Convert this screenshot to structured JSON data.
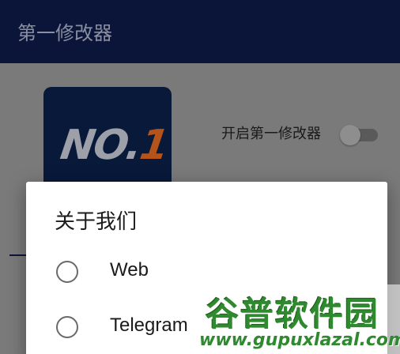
{
  "appbar": {
    "title": "第一修改器"
  },
  "logo": {
    "text_main": "NO.",
    "text_accent": "1"
  },
  "toggle": {
    "label": "开启第一修改器",
    "enabled": false
  },
  "dialog": {
    "title": "关于我们",
    "options": [
      {
        "label": "Web",
        "selected": false
      },
      {
        "label": "Telegram",
        "selected": false
      }
    ]
  },
  "watermark": {
    "brand": "谷普软件园",
    "url": "www.gupuxlazal.com"
  },
  "colors": {
    "appbar": "#0a1539",
    "logo_bg": "#08193a",
    "logo_accent": "#b5541a",
    "watermark": "#2f8a2f"
  }
}
